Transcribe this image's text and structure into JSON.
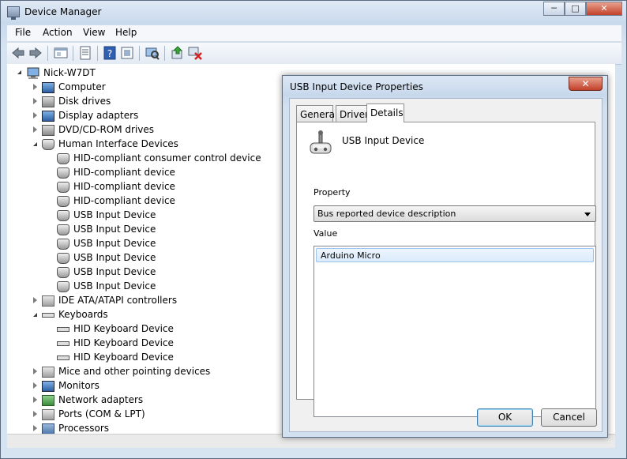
{
  "window": {
    "title": "Device Manager",
    "controls": {
      "minimize": "─",
      "maximize": "□",
      "close": "✕"
    }
  },
  "menu": [
    "File",
    "Action",
    "View",
    "Help"
  ],
  "toolbar": {
    "icons": [
      "back-icon",
      "forward-icon",
      "properties-view-icon",
      "show-hide-icon",
      "help-icon",
      "update-driver-icon",
      "scan-hardware-icon",
      "enable-device-icon",
      "uninstall-icon"
    ]
  },
  "tree": {
    "root": "Nick-W7DT",
    "items": [
      {
        "label": "Computer",
        "state": "collapsed",
        "indent": 1,
        "icon": "computer-icon"
      },
      {
        "label": "Disk drives",
        "state": "collapsed",
        "indent": 1,
        "icon": "disk-drive-icon"
      },
      {
        "label": "Display adapters",
        "state": "collapsed",
        "indent": 1,
        "icon": "display-adapter-icon"
      },
      {
        "label": "DVD/CD-ROM drives",
        "state": "collapsed",
        "indent": 1,
        "icon": "dvd-drive-icon"
      },
      {
        "label": "Human Interface Devices",
        "state": "expanded",
        "indent": 1,
        "icon": "hid-icon"
      },
      {
        "label": "HID-compliant consumer control device",
        "state": "leaf",
        "indent": 2,
        "icon": "hid-device-icon"
      },
      {
        "label": "HID-compliant device",
        "state": "leaf",
        "indent": 2,
        "icon": "hid-device-icon"
      },
      {
        "label": "HID-compliant device",
        "state": "leaf",
        "indent": 2,
        "icon": "hid-device-icon"
      },
      {
        "label": "HID-compliant device",
        "state": "leaf",
        "indent": 2,
        "icon": "hid-device-icon"
      },
      {
        "label": "USB Input Device",
        "state": "leaf",
        "indent": 2,
        "icon": "hid-device-icon"
      },
      {
        "label": "USB Input Device",
        "state": "leaf",
        "indent": 2,
        "icon": "hid-device-icon"
      },
      {
        "label": "USB Input Device",
        "state": "leaf",
        "indent": 2,
        "icon": "hid-device-icon"
      },
      {
        "label": "USB Input Device",
        "state": "leaf",
        "indent": 2,
        "icon": "hid-device-icon"
      },
      {
        "label": "USB Input Device",
        "state": "leaf",
        "indent": 2,
        "icon": "hid-device-icon"
      },
      {
        "label": "USB Input Device",
        "state": "leaf",
        "indent": 2,
        "icon": "hid-device-icon"
      },
      {
        "label": "IDE ATA/ATAPI controllers",
        "state": "collapsed",
        "indent": 1,
        "icon": "ide-controller-icon"
      },
      {
        "label": "Keyboards",
        "state": "expanded",
        "indent": 1,
        "icon": "keyboard-icon"
      },
      {
        "label": "HID Keyboard Device",
        "state": "leaf",
        "indent": 2,
        "icon": "keyboard-icon"
      },
      {
        "label": "HID Keyboard Device",
        "state": "leaf",
        "indent": 2,
        "icon": "keyboard-icon"
      },
      {
        "label": "HID Keyboard Device",
        "state": "leaf",
        "indent": 2,
        "icon": "keyboard-icon"
      },
      {
        "label": "Mice and other pointing devices",
        "state": "collapsed",
        "indent": 1,
        "icon": "mouse-icon"
      },
      {
        "label": "Monitors",
        "state": "collapsed",
        "indent": 1,
        "icon": "monitor-icon"
      },
      {
        "label": "Network adapters",
        "state": "collapsed",
        "indent": 1,
        "icon": "network-adapter-icon"
      },
      {
        "label": "Ports (COM & LPT)",
        "state": "collapsed",
        "indent": 1,
        "icon": "port-icon"
      },
      {
        "label": "Processors",
        "state": "collapsed",
        "indent": 1,
        "icon": "processor-icon"
      }
    ]
  },
  "dialog": {
    "title": "USB Input Device Properties",
    "close": "✕",
    "tabs": [
      "General",
      "Driver",
      "Details"
    ],
    "active_tab": "Details",
    "device_name": "USB Input Device",
    "property_label": "Property",
    "property_value": "Bus reported device description",
    "value_label": "Value",
    "values": [
      "Arduino Micro"
    ],
    "ok_label": "OK",
    "cancel_label": "Cancel"
  }
}
